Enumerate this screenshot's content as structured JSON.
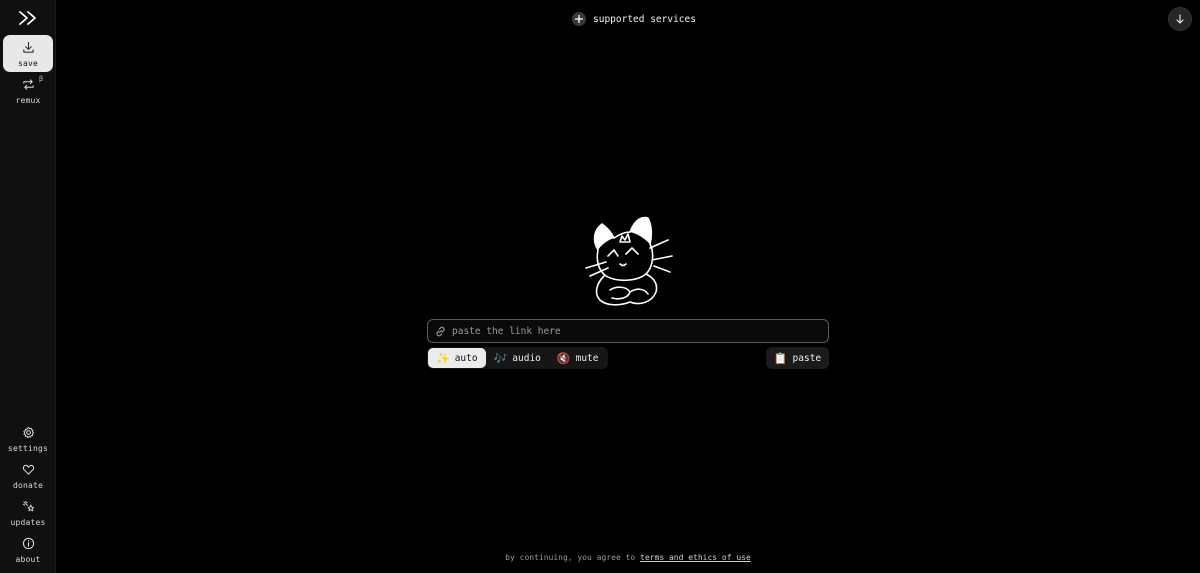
{
  "sidebar": {
    "top_items": [
      {
        "label": "save",
        "icon": "download-icon",
        "active": true
      },
      {
        "label": "remux",
        "icon": "remux-icon",
        "badge": "β"
      }
    ],
    "bottom_items": [
      {
        "label": "settings",
        "icon": "gear-icon"
      },
      {
        "label": "donate",
        "icon": "heart-icon"
      },
      {
        "label": "updates",
        "icon": "sparkle-icon"
      },
      {
        "label": "about",
        "icon": "info-icon"
      }
    ]
  },
  "header": {
    "services_label": "supported services"
  },
  "main": {
    "link_placeholder": "paste the link here",
    "modes": [
      {
        "label": "auto",
        "emoji": "✨",
        "active": true
      },
      {
        "label": "audio",
        "emoji": "🎶"
      },
      {
        "label": "mute",
        "emoji": "🔇"
      }
    ],
    "paste_label": "paste",
    "paste_emoji": "📋"
  },
  "footer": {
    "prefix": "by continuing, you agree to",
    "link": "terms and ethics of use"
  },
  "colors": {
    "background": "#000000",
    "sidebar": "#101010",
    "active": "#e8e8e8"
  }
}
